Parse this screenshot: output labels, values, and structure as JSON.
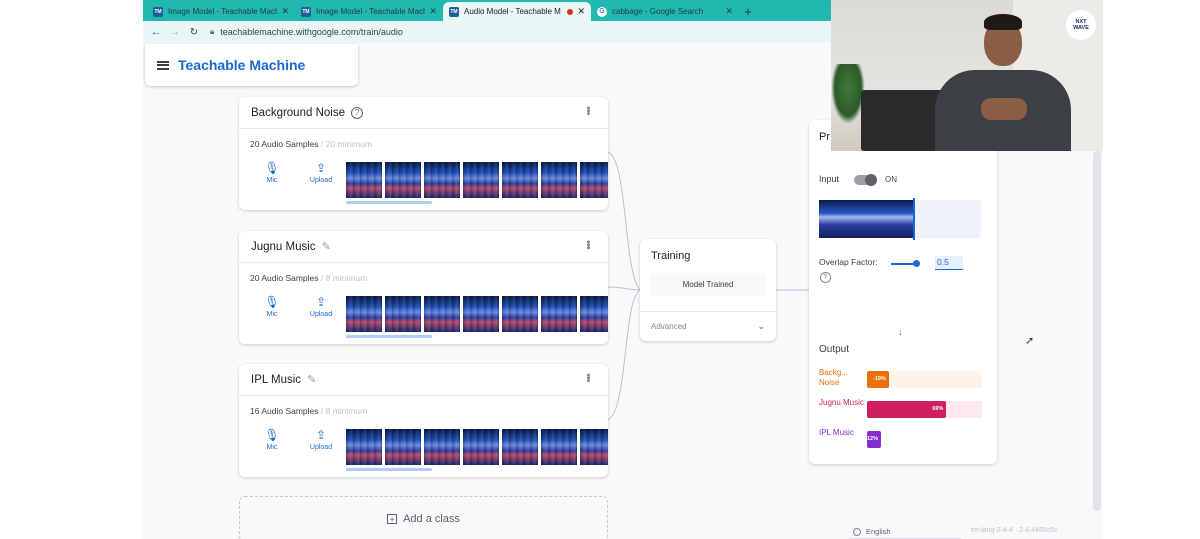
{
  "browser": {
    "tabs": [
      {
        "title": "Image Model - Teachable Machi",
        "favicon": "TM",
        "active": false
      },
      {
        "title": "Image Model - Teachable Machi",
        "favicon": "TM",
        "active": false
      },
      {
        "title": "Audio Model - Teachable M",
        "favicon": "TM",
        "active": true
      },
      {
        "title": "cabbage - Google Search",
        "favicon": "G",
        "active": false
      }
    ],
    "url": "teachablemachine.withgoogle.com/train/audio",
    "newtab_icon": "plus-icon"
  },
  "app": {
    "title": "Teachable Machine"
  },
  "classes": [
    {
      "name": "Background Noise",
      "name_icon": "help-icon",
      "count": "20 Audio Samples",
      "min": "/ 20 minimum",
      "mic_label": "Mic",
      "upload_label": "Upload",
      "thumbs": 7
    },
    {
      "name": "Jugnu Music",
      "name_icon": "pencil-icon",
      "count": "20 Audio Samples",
      "min": "/ 8 minimum",
      "mic_label": "Mic",
      "upload_label": "Upload",
      "thumbs": 7
    },
    {
      "name": "IPL Music",
      "name_icon": "pencil-icon",
      "count": "16 Audio Samples",
      "min": "/ 8 minimum",
      "mic_label": "Mic",
      "upload_label": "Upload",
      "thumbs": 7
    }
  ],
  "add_class": {
    "label": "Add a class"
  },
  "training": {
    "title": "Training",
    "status": "Model Trained",
    "advanced": "Advanced"
  },
  "preview": {
    "title": "Pr",
    "input_label": "Input",
    "toggle_state": "ON",
    "overlap_label": "Overlap Factor:",
    "overlap_value": "0.5",
    "output_label": "Output",
    "outputs": [
      {
        "name": "Backg... Noise",
        "value": 0.19,
        "text": "-19%",
        "color": "#e8710a",
        "bg": "#fef3e6",
        "label_color": "#e8710a"
      },
      {
        "name": "Jugnu Music",
        "value": 0.69,
        "text": "69%",
        "color": "#d01f5f",
        "bg": "#fce8ee",
        "label_color": "#d01f5f"
      },
      {
        "name": "IPL Music",
        "value": 0.11,
        "text": "12%",
        "color": "#8430ce",
        "bg": "#ffffff",
        "label_color": "#8430ce"
      }
    ]
  },
  "webcam": {
    "logo_line1": "NXT",
    "logo_line2": "WAVE"
  },
  "footer": {
    "language": "English",
    "version": "tm-lang-2-4-4 · 2.4.4495c6c"
  }
}
